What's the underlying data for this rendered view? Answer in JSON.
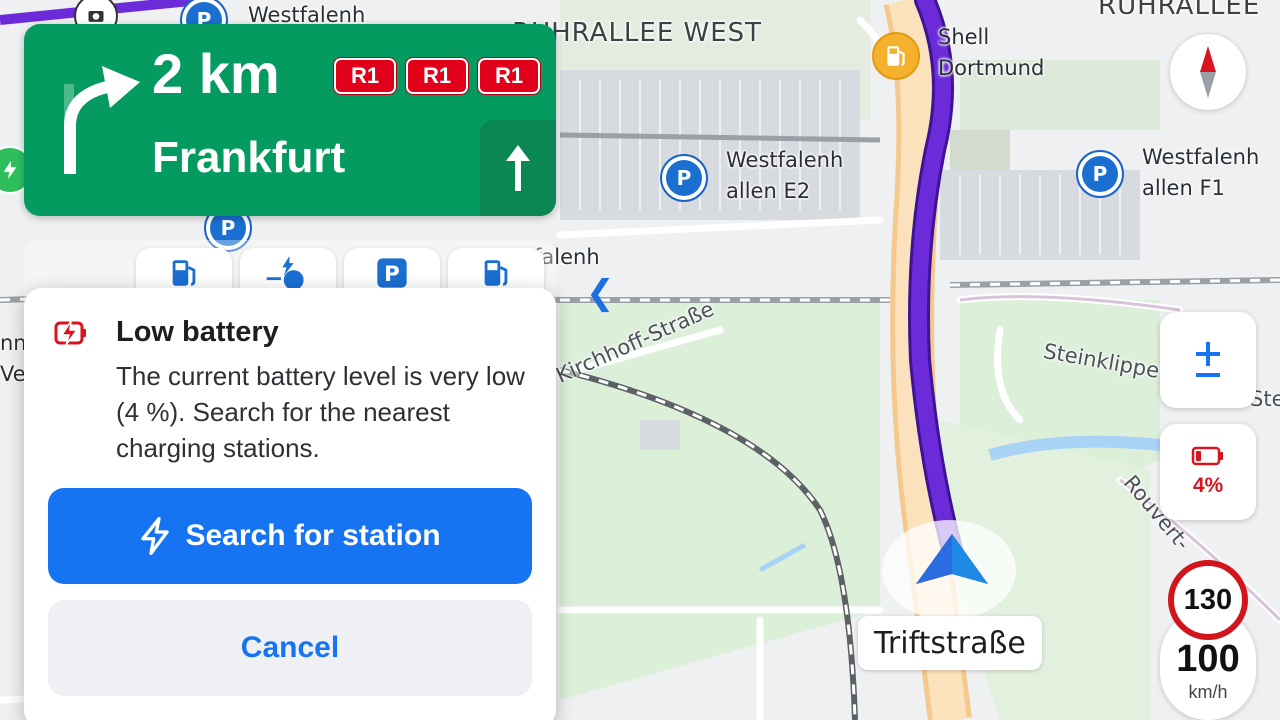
{
  "map": {
    "labels": {
      "westfalenhallen_top": "Westfalenh",
      "ruhrallee_west": "RUHRALLEE WEST",
      "ruhrallee_right": "RUHRALLEE",
      "shell": "Shell",
      "dortmund": "Dortmund",
      "westfalenhallen_e2_l1": "Westfalenh",
      "westfalenhallen_e2_l2": "allen E2",
      "westfalenhallen_f1_l1": "Westfalenh",
      "westfalenhallen_f1_l2": "allen F1",
      "westfalenhallen_mid": "falenh",
      "kirchhoff": "Kirchhoff-Straße",
      "steinklippen": "Steinklippe",
      "ste": "Ste",
      "rouvert": "Rouvert-",
      "nn": "nn",
      "ve": "Ve"
    }
  },
  "nav_banner": {
    "distance": "2 km",
    "destination": "Frankfurt",
    "shields": [
      "R1",
      "R1",
      "R1"
    ]
  },
  "category_strip": {
    "items": [
      "fuel-station",
      "ev-charger",
      "parking",
      "fuel-station"
    ]
  },
  "dialog": {
    "title": "Low battery",
    "body": "The current battery level is very low (4 %). Search for the nearest charging stations.",
    "primary_label": "Search for station",
    "cancel_label": "Cancel"
  },
  "controls": {
    "battery_percent": "4%",
    "battery_level": 0.04,
    "speed_limit": "130",
    "current_speed": "100",
    "speed_unit": "km/h"
  },
  "current_street": "Triftstraße",
  "colors": {
    "banner_green": "#059a5f",
    "route_purple": "#6b2bd9",
    "primary_blue": "#1674f2",
    "alert_red": "#d8141f"
  }
}
